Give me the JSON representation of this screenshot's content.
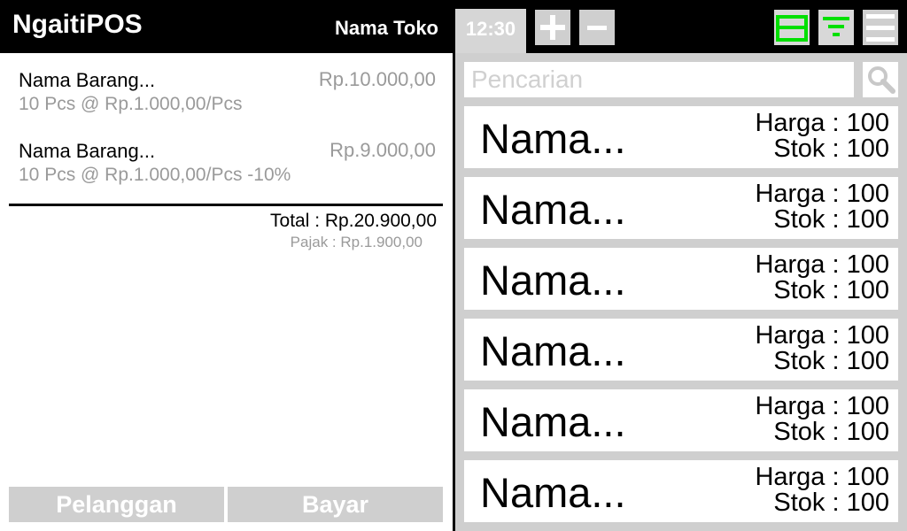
{
  "header": {
    "app_title": "NgaitiPOS",
    "store_name": "Nama Toko"
  },
  "cart": {
    "items": [
      {
        "name": "Nama Barang...",
        "total": "Rp.10.000,00",
        "detail": "10 Pcs @ Rp.1.000,00/Pcs"
      },
      {
        "name": "Nama Barang...",
        "total": "Rp.9.000,00",
        "detail": "10 Pcs @ Rp.1.000,00/Pcs -10%"
      }
    ],
    "total": "Total : Rp.20.900,00",
    "tax": "Pajak : Rp.1.900,00"
  },
  "actions": {
    "customer_label": "Pelanggan",
    "pay_label": "Bayar"
  },
  "toolbar": {
    "time": "12:30",
    "icons": [
      "plus-icon",
      "minus-icon",
      "printer-icon",
      "filter-icon",
      "menu-icon"
    ],
    "accent_color": "#00e000"
  },
  "search": {
    "placeholder": "Pencarian"
  },
  "products": [
    {
      "name": "Nama...",
      "price": "Harga : 100",
      "stock": "Stok : 100"
    },
    {
      "name": "Nama...",
      "price": "Harga : 100",
      "stock": "Stok : 100"
    },
    {
      "name": "Nama...",
      "price": "Harga : 100",
      "stock": "Stok : 100"
    },
    {
      "name": "Nama...",
      "price": "Harga : 100",
      "stock": "Stok : 100"
    },
    {
      "name": "Nama...",
      "price": "Harga : 100",
      "stock": "Stok : 100"
    },
    {
      "name": "Nama...",
      "price": "Harga : 100",
      "stock": "Stok : 100"
    }
  ]
}
